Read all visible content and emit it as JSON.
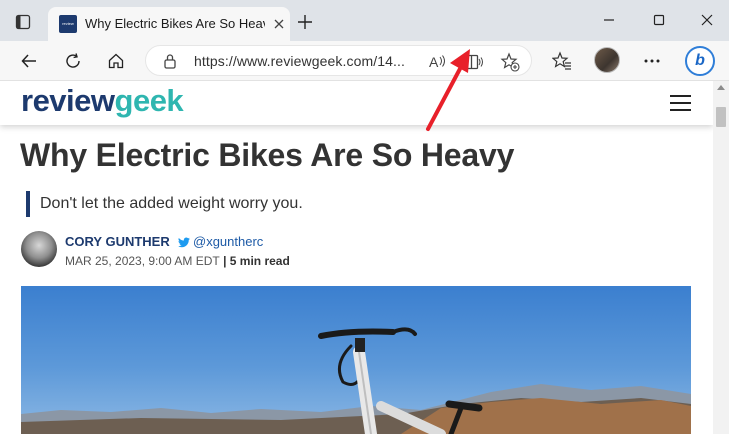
{
  "browser": {
    "tab": {
      "title": "Why Electric Bikes Are So Heavy",
      "favicon_text": "review geek"
    },
    "address_bar": {
      "url": "https://www.reviewgeek.com/14..."
    },
    "icons": {
      "tab_actions": "tab-actions-icon",
      "close_tab": "close-icon",
      "new_tab": "plus-icon",
      "minimize": "minimize-icon",
      "maximize": "maximize-icon",
      "close_window": "close-window-icon",
      "back": "back-arrow-icon",
      "refresh": "refresh-icon",
      "home": "home-icon",
      "lock": "lock-icon",
      "read_aloud": "read-aloud-icon",
      "immersive_reader": "immersive-reader-icon",
      "add_favorite": "add-favorite-icon",
      "favorites": "favorites-icon",
      "more": "more-icon",
      "copilot": "bing-copilot-icon"
    }
  },
  "site": {
    "logo_part1": "review",
    "logo_part2": "geek",
    "menu_icon": "hamburger-menu-icon",
    "brand_color": "#1d3a6e",
    "accent_color": "#2fb6b0"
  },
  "article": {
    "title": "Why Electric Bikes Are So Heavy",
    "dek": "Don't let the added weight worry you.",
    "author": "CORY GUNTHER",
    "handle": "@xguntherc",
    "date": "MAR 25, 2023, 9:00 AM EDT",
    "separator": " | ",
    "read_time": "5 min read"
  },
  "annotation": {
    "arrow_color": "#e8202a"
  }
}
